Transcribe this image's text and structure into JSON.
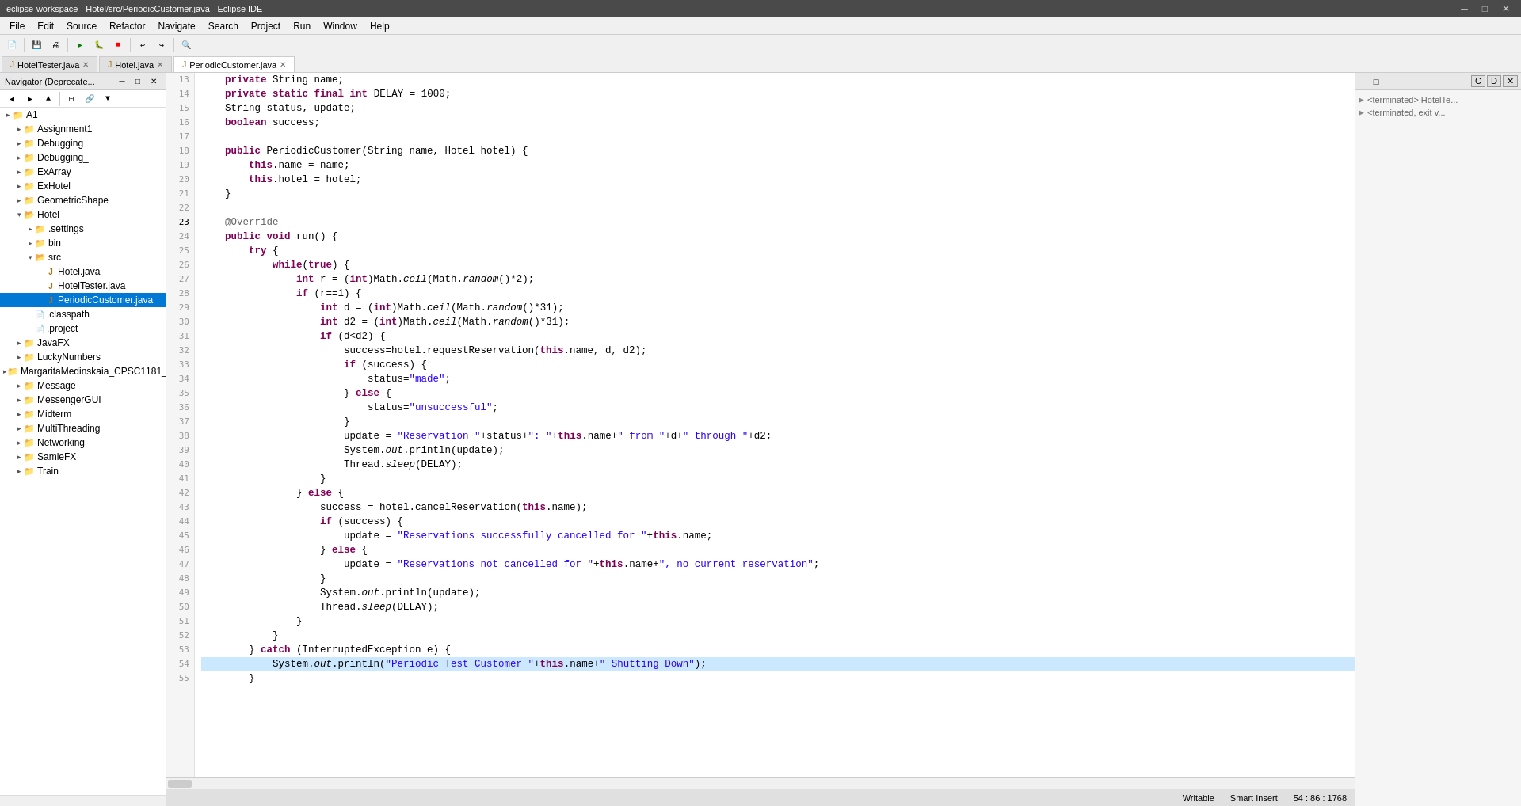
{
  "titleBar": {
    "title": "eclipse-workspace - Hotel/src/PeriodicCustomer.java - Eclipse IDE",
    "minimize": "−",
    "maximize": "□",
    "close": "✕"
  },
  "menuBar": {
    "items": [
      "File",
      "Edit",
      "Source",
      "Refactor",
      "Navigate",
      "Search",
      "Project",
      "Run",
      "Window",
      "Help"
    ]
  },
  "tabs": {
    "items": [
      {
        "label": "HotelTester.java",
        "active": false,
        "closeable": true
      },
      {
        "label": "Hotel.java",
        "active": false,
        "closeable": true
      },
      {
        "label": "PeriodicCustomer.java",
        "active": true,
        "closeable": true
      }
    ]
  },
  "navigator": {
    "title": "Navigator (Deprecate...",
    "tree": [
      {
        "label": "A1",
        "indent": 0,
        "expanded": false,
        "type": "folder"
      },
      {
        "label": "Assignment1",
        "indent": 1,
        "expanded": false,
        "type": "folder"
      },
      {
        "label": "Debugging",
        "indent": 1,
        "expanded": false,
        "type": "folder"
      },
      {
        "label": "Debugging_",
        "indent": 1,
        "expanded": false,
        "type": "folder"
      },
      {
        "label": "ExArray",
        "indent": 1,
        "expanded": false,
        "type": "folder"
      },
      {
        "label": "ExHotel",
        "indent": 1,
        "expanded": false,
        "type": "folder"
      },
      {
        "label": "GeometricShape",
        "indent": 1,
        "expanded": false,
        "type": "folder"
      },
      {
        "label": "Hotel",
        "indent": 1,
        "expanded": true,
        "type": "folder"
      },
      {
        "label": ".settings",
        "indent": 2,
        "expanded": false,
        "type": "folder"
      },
      {
        "label": "bin",
        "indent": 2,
        "expanded": false,
        "type": "folder"
      },
      {
        "label": "src",
        "indent": 2,
        "expanded": true,
        "type": "folder"
      },
      {
        "label": "Hotel.java",
        "indent": 3,
        "expanded": false,
        "type": "java"
      },
      {
        "label": "HotelTester.java",
        "indent": 3,
        "expanded": false,
        "type": "java"
      },
      {
        "label": "PeriodicCustomer.java",
        "indent": 3,
        "expanded": false,
        "type": "java",
        "selected": true
      },
      {
        "label": ".classpath",
        "indent": 2,
        "expanded": false,
        "type": "file"
      },
      {
        "label": ".project",
        "indent": 2,
        "expanded": false,
        "type": "file"
      },
      {
        "label": "JavaFX",
        "indent": 1,
        "expanded": false,
        "type": "folder"
      },
      {
        "label": "LuckyNumbers",
        "indent": 1,
        "expanded": false,
        "type": "folder"
      },
      {
        "label": "MargaritaMedinskaia_CPSC1181_",
        "indent": 1,
        "expanded": false,
        "type": "folder"
      },
      {
        "label": "Message",
        "indent": 1,
        "expanded": false,
        "type": "folder"
      },
      {
        "label": "MessengerGUI",
        "indent": 1,
        "expanded": false,
        "type": "folder"
      },
      {
        "label": "Midterm",
        "indent": 1,
        "expanded": false,
        "type": "folder"
      },
      {
        "label": "MultiThreading",
        "indent": 1,
        "expanded": false,
        "type": "folder"
      },
      {
        "label": "Networking",
        "indent": 1,
        "expanded": false,
        "type": "folder"
      },
      {
        "label": "SamleFX",
        "indent": 1,
        "expanded": false,
        "type": "folder"
      },
      {
        "label": "Train",
        "indent": 1,
        "expanded": false,
        "type": "folder"
      }
    ]
  },
  "code": {
    "lines": [
      {
        "num": 13,
        "content": "    <kw>private</kw> String name;"
      },
      {
        "num": 14,
        "content": "    <kw>private</kw> <kw>static</kw> <kw>final</kw> <kw2>int</kw2> DELAY = 1000;"
      },
      {
        "num": 15,
        "content": "    String status, update;"
      },
      {
        "num": 16,
        "content": "    <kw2>boolean</kw2> success;"
      },
      {
        "num": 17,
        "content": ""
      },
      {
        "num": 18,
        "content": "    <kw>public</kw> PeriodicCustomer(String name, Hotel hotel) {"
      },
      {
        "num": 19,
        "content": "        <kw>this</kw>.name = name;"
      },
      {
        "num": 20,
        "content": "        <kw>this</kw>.hotel = hotel;"
      },
      {
        "num": 21,
        "content": "    }"
      },
      {
        "num": 22,
        "content": ""
      },
      {
        "num": 23,
        "content": "    <ann>@Override</ann>"
      },
      {
        "num": 24,
        "content": "    <kw>public</kw> <kw2>void</kw2> run() {"
      },
      {
        "num": 25,
        "content": "        <kw>try</kw> {"
      },
      {
        "num": 26,
        "content": "            <kw>while</kw>(<kw2>true</kw2>) {"
      },
      {
        "num": 27,
        "content": "                <kw2>int</kw2> r = (<kw2>int</kw2>)Math.<i>ceil</i>(Math.<i>random</i>()*2);"
      },
      {
        "num": 28,
        "content": "                <kw>if</kw> (r==1) {"
      },
      {
        "num": 29,
        "content": "                    <kw2>int</kw2> d = (<kw2>int</kw2>)Math.<i>ceil</i>(Math.<i>random</i>()*31);"
      },
      {
        "num": 30,
        "content": "                    <kw2>int</kw2> d2 = (<kw2>int</kw2>)Math.<i>ceil</i>(Math.<i>random</i>()*31);"
      },
      {
        "num": 31,
        "content": "                    <kw>if</kw> (d&lt;d2) {"
      },
      {
        "num": 32,
        "content": "                        success=hotel.requestReservation(<kw>this</kw>.name, d, d2);"
      },
      {
        "num": 33,
        "content": "                        <kw>if</kw> (success) {"
      },
      {
        "num": 34,
        "content": "                            status=<str>\"made\"</str>;"
      },
      {
        "num": 35,
        "content": "                        } <kw>else</kw> {"
      },
      {
        "num": 36,
        "content": "                            status=<str>\"unsuccessful\"</str>;"
      },
      {
        "num": 37,
        "content": "                        }"
      },
      {
        "num": 38,
        "content": "                        update = <str>\"Reservation \"</str>+status+<str>\": \"</str>+<kw>this</kw>.name+<str>\" from \"</str>+d+<str>\" through \"</str>+d2;"
      },
      {
        "num": 39,
        "content": "                        System.<i>out</i>.println(update);"
      },
      {
        "num": 40,
        "content": "                        Thread.<i>sleep</i>(DELAY);"
      },
      {
        "num": 41,
        "content": "                    }"
      },
      {
        "num": 42,
        "content": "                } <kw>else</kw> {"
      },
      {
        "num": 43,
        "content": "                    success = hotel.cancelReservation(<kw>this</kw>.name);"
      },
      {
        "num": 44,
        "content": "                    <kw>if</kw> (success) {"
      },
      {
        "num": 45,
        "content": "                        update = <str>\"Reservations successfully cancelled for \"</str>+<kw>this</kw>.name;"
      },
      {
        "num": 46,
        "content": "                    } <kw>else</kw> {"
      },
      {
        "num": 47,
        "content": "                        update = <str>\"Reservations not cancelled for \"</str>+<kw>this</kw>.name+<str>\", no current reservation\"</str>;"
      },
      {
        "num": 48,
        "content": "                    }"
      },
      {
        "num": 49,
        "content": "                    System.<i>out</i>.println(update);"
      },
      {
        "num": 50,
        "content": "                    Thread.<i>sleep</i>(DELAY);"
      },
      {
        "num": 51,
        "content": "                }"
      },
      {
        "num": 52,
        "content": "            }"
      },
      {
        "num": 53,
        "content": "        } <kw>catch</kw> (InterruptedException e) {"
      },
      {
        "num": 54,
        "content": "            System.<i>out</i>.println(<str>\"Periodic Test Customer \"</str>+<kw>this</kw>.name+<str>\" Shutting Down\"</str>);",
        "highlighted": true
      },
      {
        "num": 55,
        "content": "        }"
      }
    ]
  },
  "statusBar": {
    "writable": "Writable",
    "smartInsert": "Smart Insert",
    "position": "54 : 86 : 1768"
  },
  "rightPanel": {
    "tabs": [
      "C",
      "D",
      "×"
    ],
    "items": [
      {
        "label": "<terminated> HotelTe...",
        "type": "terminated"
      },
      {
        "label": "<terminated, exit v...",
        "type": "terminated"
      }
    ]
  }
}
